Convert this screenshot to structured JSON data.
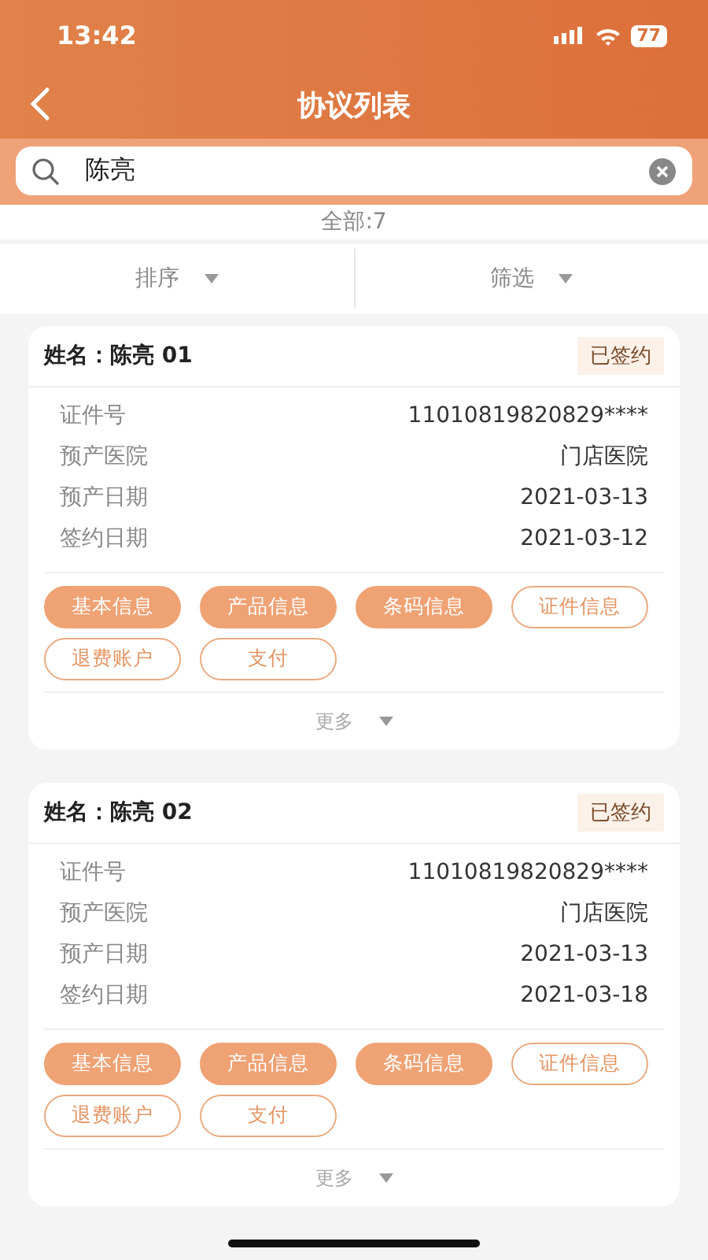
{
  "status_bar": {
    "time": "13:42",
    "battery": "77"
  },
  "nav": {
    "title": "协议列表"
  },
  "search": {
    "value": "陈亮"
  },
  "count": "全部:7",
  "toolbar": [
    {
      "label": "排序"
    },
    {
      "label": "筛选"
    }
  ],
  "cards": [
    {
      "name": "姓名：陈亮 01",
      "status": "已签约",
      "fields": [
        {
          "label": "证件号",
          "value": "11010819820829****"
        },
        {
          "label": "预产医院",
          "value": "门店医院"
        },
        {
          "label": "预产日期",
          "value": "2021-03-13"
        },
        {
          "label": "签约日期",
          "value": "2021-03-12"
        }
      ],
      "actions": [
        {
          "label": "基本信息",
          "kind": "filled"
        },
        {
          "label": "产品信息",
          "kind": "filled"
        },
        {
          "label": "条码信息",
          "kind": "filled"
        },
        {
          "label": "证件信息",
          "kind": "outline"
        },
        {
          "label": "退费账户",
          "kind": "outline"
        },
        {
          "label": "支付",
          "kind": "outline"
        }
      ],
      "more": "更多"
    },
    {
      "name": "姓名：陈亮 02",
      "status": "已签约",
      "fields": [
        {
          "label": "证件号",
          "value": "11010819820829****"
        },
        {
          "label": "预产医院",
          "value": "门店医院"
        },
        {
          "label": "预产日期",
          "value": "2021-03-13"
        },
        {
          "label": "签约日期",
          "value": "2021-03-18"
        }
      ],
      "actions": [
        {
          "label": "基本信息",
          "kind": "filled"
        },
        {
          "label": "产品信息",
          "kind": "filled"
        },
        {
          "label": "条码信息",
          "kind": "filled"
        },
        {
          "label": "证件信息",
          "kind": "outline"
        },
        {
          "label": "退费账户",
          "kind": "outline"
        },
        {
          "label": "支付",
          "kind": "outline"
        }
      ],
      "more": "更多"
    }
  ]
}
